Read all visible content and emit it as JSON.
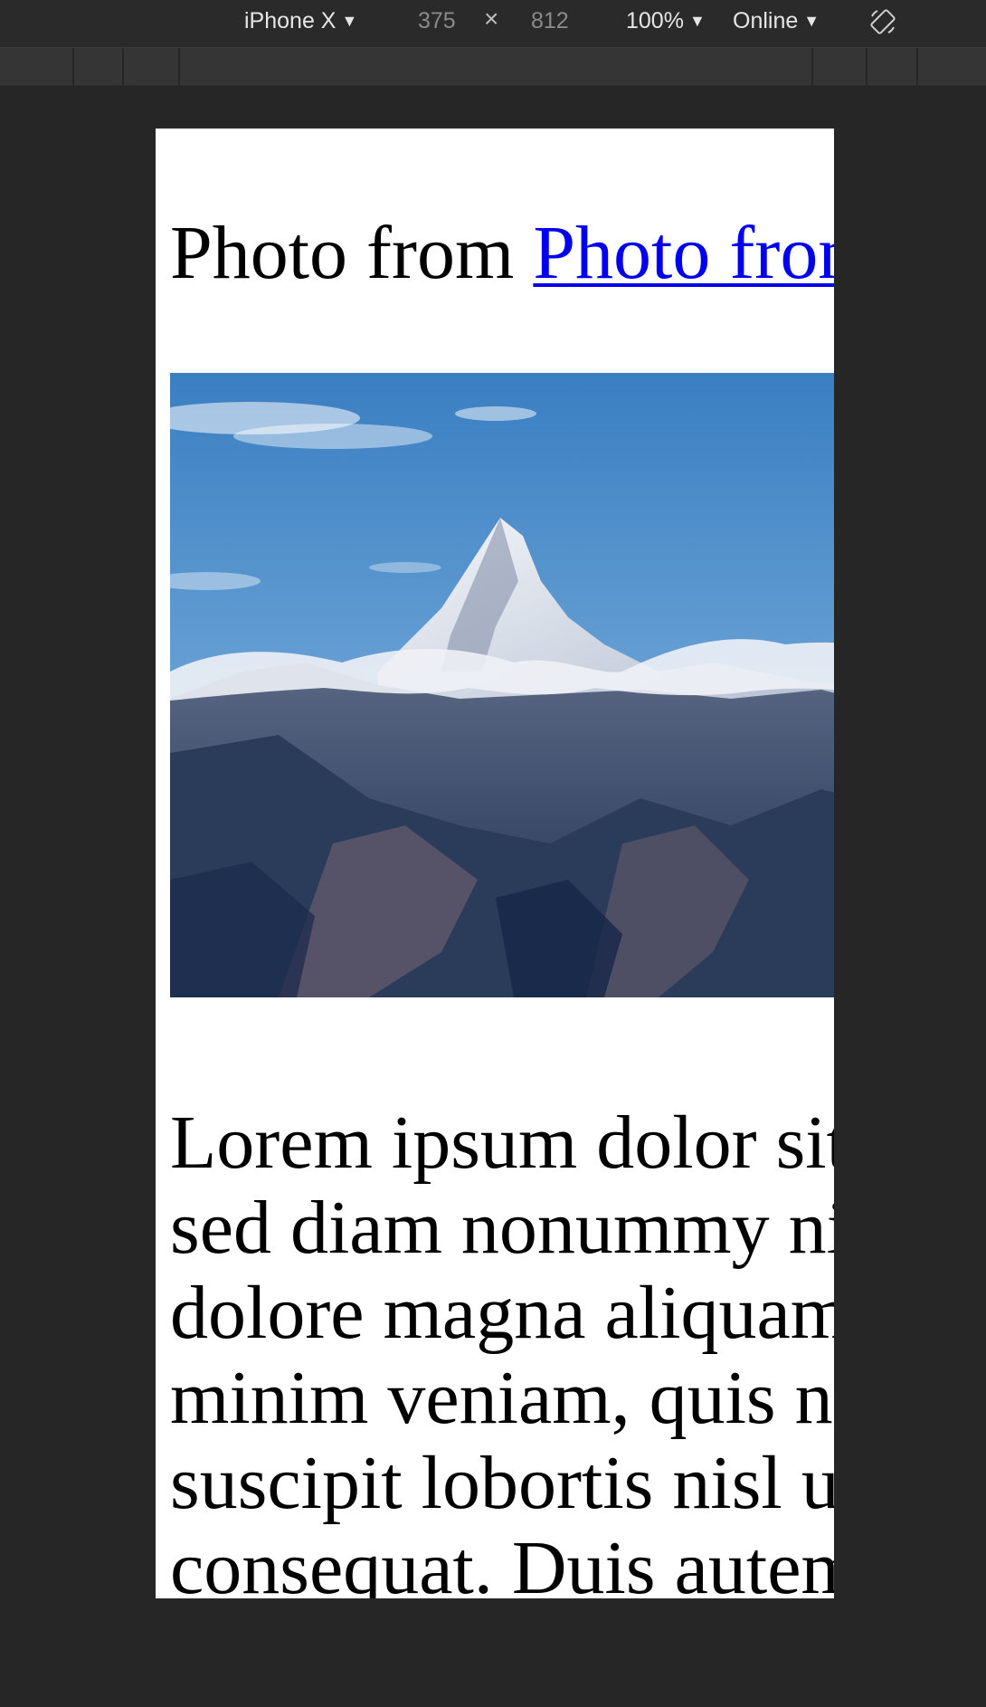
{
  "toolbar": {
    "device": "iPhone X",
    "width": "375",
    "times": "×",
    "height": "812",
    "zoom": "100%",
    "network": "Online"
  },
  "page": {
    "heading_text": "Photo from ",
    "heading_link": "Photo from",
    "image_alt": "Mountain peak above clouds",
    "paragraph_lines": [
      "Lorem ipsum dolor sit",
      "sed diam nonummy ni",
      "dolore magna aliquam",
      "minim veniam, quis no",
      "suscipit lobortis nisl u",
      "consequat. Duis autem"
    ]
  },
  "colors": {
    "link": "#0000ee",
    "devtools_bg": "#262626"
  }
}
